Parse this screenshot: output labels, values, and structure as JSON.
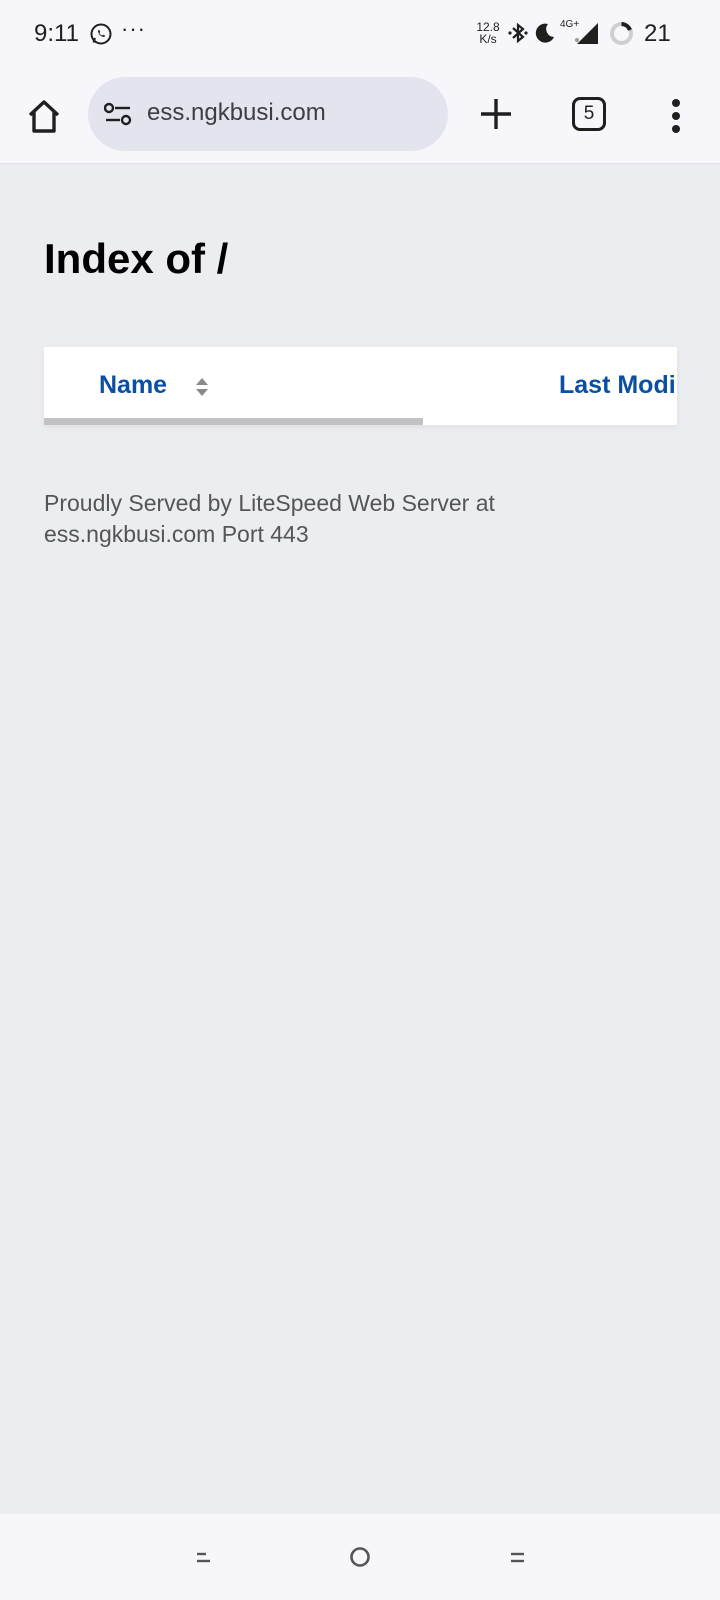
{
  "status_bar": {
    "time": "9:11",
    "speed_value": "12.8",
    "speed_unit": "K/s",
    "network": "4G+",
    "battery": "21"
  },
  "browser": {
    "url": "ess.ngkbusi.com",
    "tab_count": "5"
  },
  "page": {
    "title": "Index of /",
    "columns": {
      "name": "Name",
      "last_modified": "Last Modi"
    },
    "footer": "Proudly Served by LiteSpeed Web Server at ess.ngkbusi.com Port 443"
  }
}
